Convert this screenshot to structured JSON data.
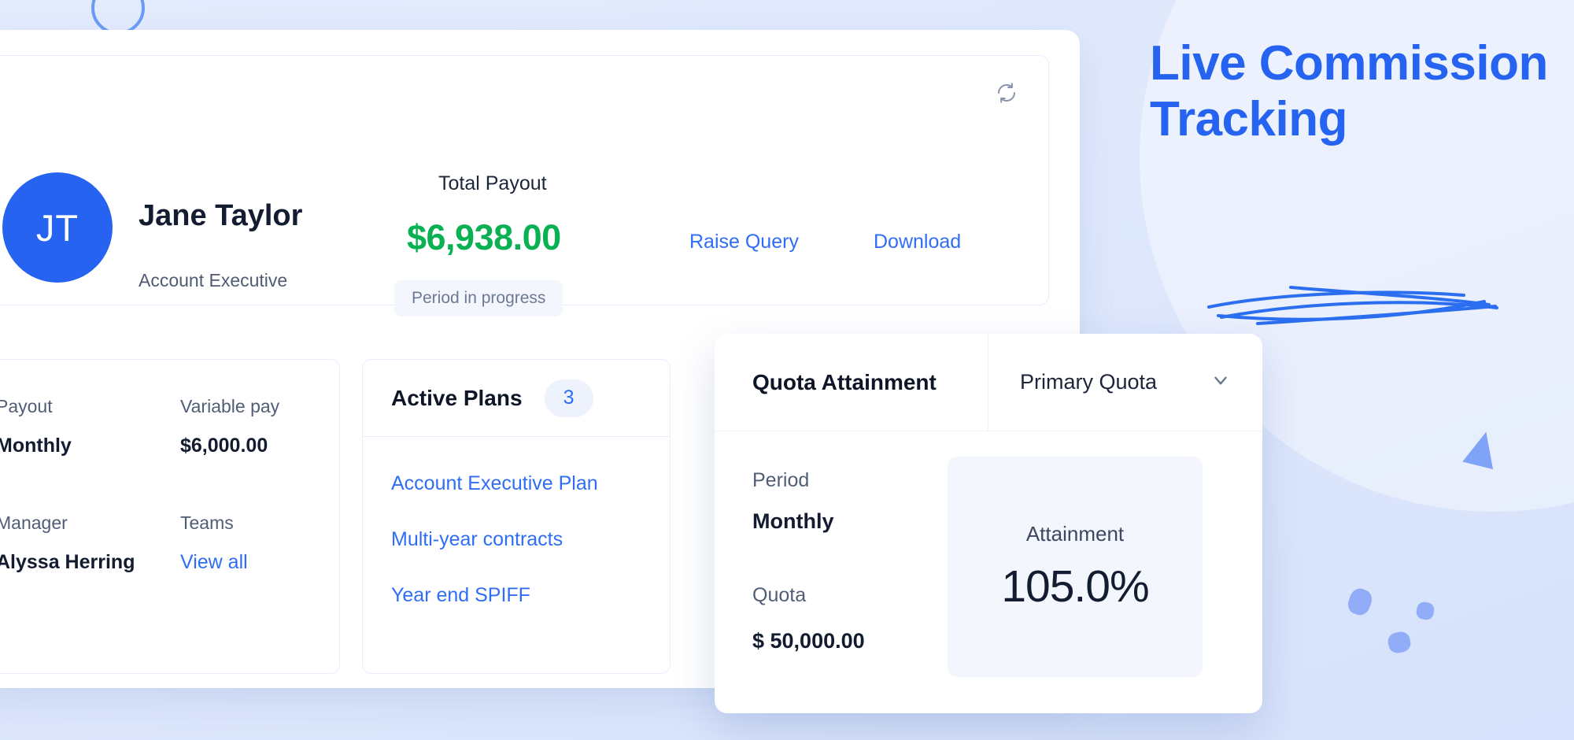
{
  "headline": "Live Commission Tracking",
  "profile": {
    "avatar_initials": "JT",
    "name": "Jane Taylor",
    "role": "Account Executive",
    "payout_label": "Total Payout",
    "payout_value": "$6,938.00",
    "payout_status": "Period in progress",
    "raise_query_label": "Raise Query",
    "download_label": "Download",
    "refresh_icon": "refresh-icon"
  },
  "details": [
    {
      "label": "Payout",
      "value": "Monthly",
      "is_link": false
    },
    {
      "label": "Variable pay",
      "value": "$6,000.00",
      "is_link": false
    },
    {
      "label": "Manager",
      "value": "Alyssa Herring",
      "is_link": false
    },
    {
      "label": "Teams",
      "value": "View all",
      "is_link": true
    }
  ],
  "plans": {
    "title": "Active Plans",
    "count": "3",
    "items": [
      "Account Executive Plan",
      "Multi-year contracts",
      "Year end SPIFF"
    ]
  },
  "quota": {
    "title": "Quota Attainment",
    "selected_quota": "Primary Quota",
    "chevron_icon": "chevron-down-icon",
    "period_label": "Period",
    "period_value": "Monthly",
    "amount_label": "Quota",
    "amount_value": "$ 50,000.00",
    "attainment_label": "Attainment",
    "attainment_value": "105.0%"
  },
  "colors": {
    "accent_blue": "#2563f0",
    "link_blue": "#2f6ef4",
    "money_green": "#09b152",
    "panel_white": "#ffffff",
    "page_bg": "#dfe8fc",
    "muted_text": "#515d76",
    "chip_bg": "#f3f6fd"
  }
}
